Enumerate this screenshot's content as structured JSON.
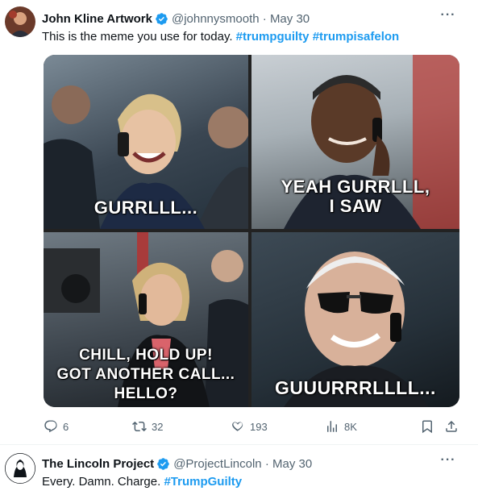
{
  "tweets": [
    {
      "name": "John Kline Artwork",
      "handle": "@johnnysmooth",
      "separator": "·",
      "date": "May 30",
      "text_plain": "This is the meme you use for today. ",
      "hashtags": [
        "#trumpguilty",
        "#trumpisafelon"
      ],
      "media": {
        "captions": [
          [
            "GURRLLL..."
          ],
          [
            "YEAH GURRLLL,",
            "I SAW"
          ],
          [
            "CHILL, HOLD UP!",
            "GOT ANOTHER CALL...",
            "HELLO?"
          ],
          [
            "GUUURRRLLLL..."
          ]
        ]
      },
      "actions": {
        "replies": "6",
        "reposts": "32",
        "likes": "193",
        "views": "8K"
      }
    },
    {
      "name": "The Lincoln Project",
      "handle": "@ProjectLincoln",
      "separator": "·",
      "date": "May 30",
      "text_plain": "Every. Damn. Charge. ",
      "hashtags": [
        "#TrumpGuilty"
      ]
    }
  ],
  "icons": {
    "verified": "verified-badge-icon",
    "more": "more-dots-icon",
    "reply": "reply-icon",
    "repost": "repost-icon",
    "like": "heart-icon",
    "views": "views-icon",
    "bookmark": "bookmark-icon",
    "share": "share-icon"
  },
  "colors": {
    "accent": "#1d9bf0",
    "text": "#0f1419",
    "muted": "#536471"
  }
}
